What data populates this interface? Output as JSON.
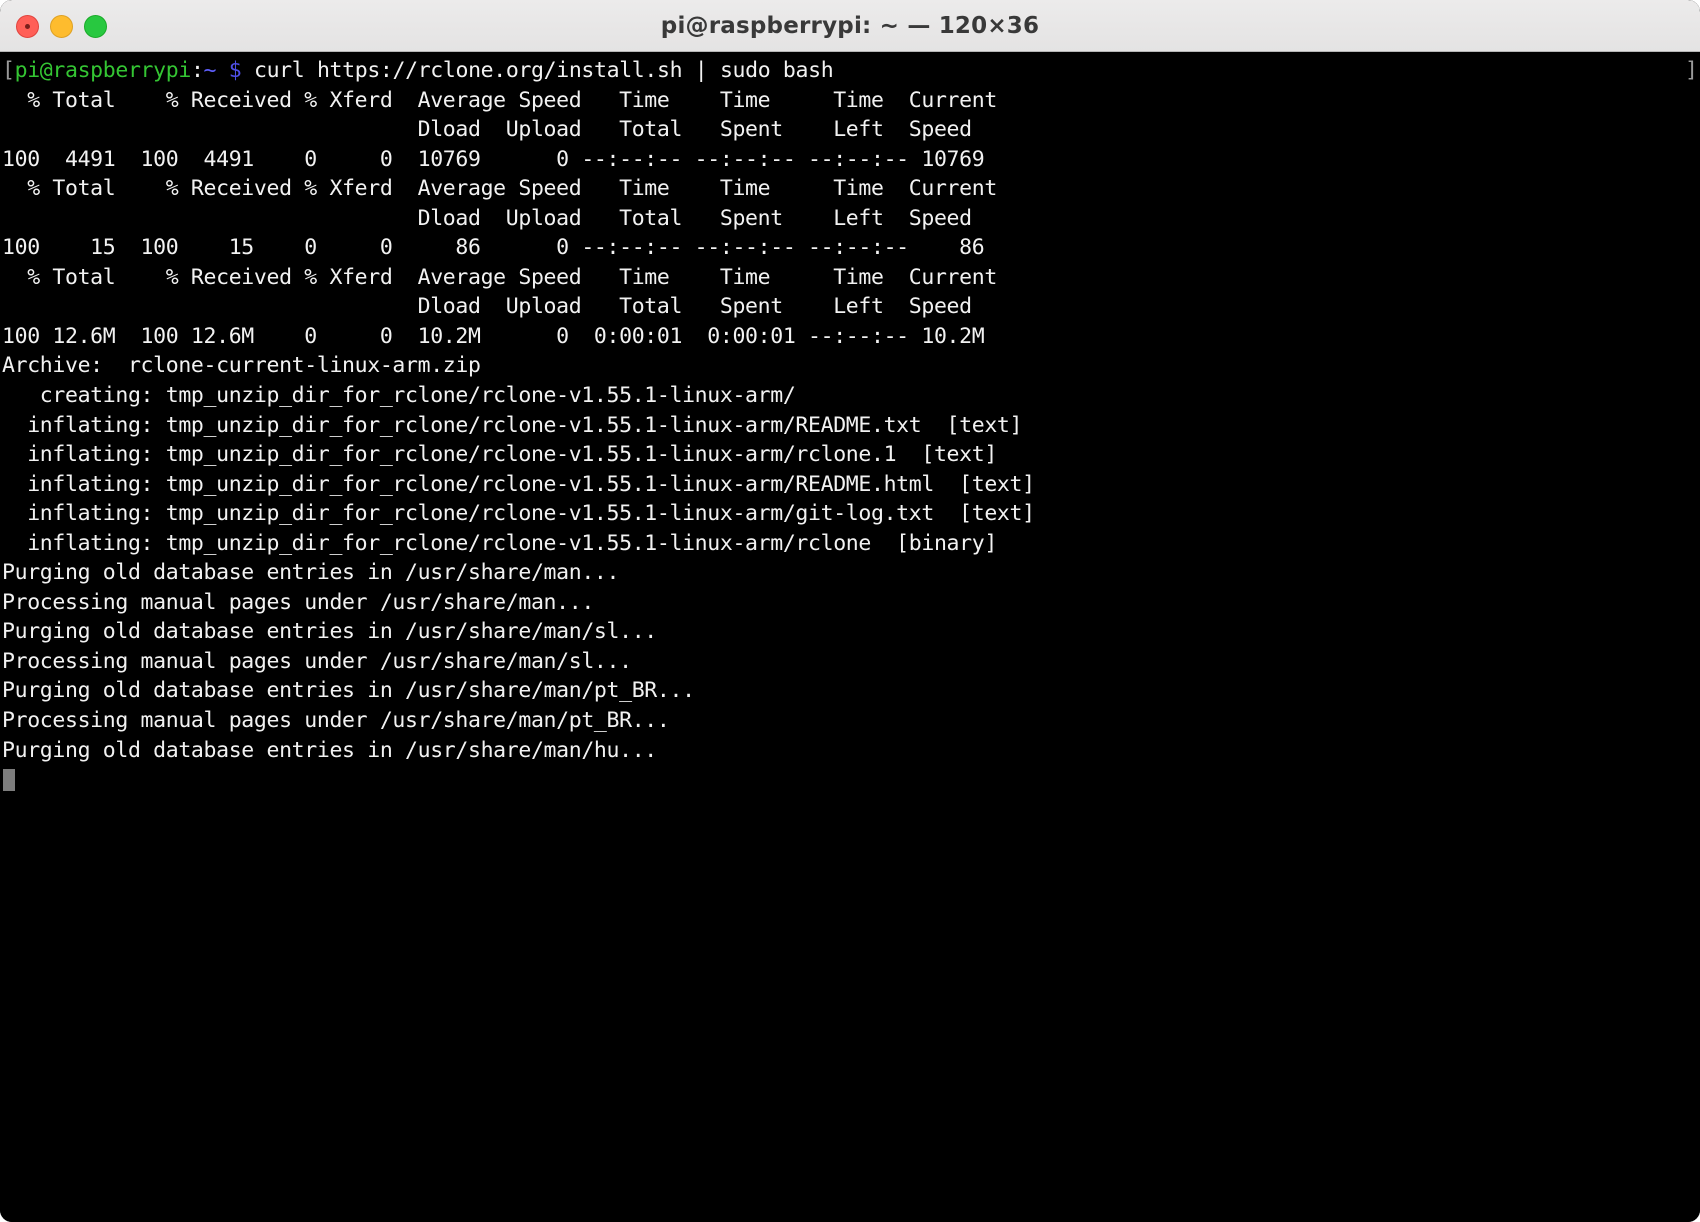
{
  "window": {
    "title": "pi@raspberrypi: ~ — 120×36",
    "columns": "120",
    "rows": "36",
    "traffic_lights": {
      "close_label": "close-window",
      "minimize_label": "minimize-window",
      "maximize_label": "maximize-window",
      "close_color": "#ff5f57",
      "minimize_color": "#febc2e",
      "maximize_color": "#28c840"
    },
    "titlebar_color": "#ebeaea",
    "background_color": "#000000",
    "foreground_color": "#f2f2f2"
  },
  "prompt": {
    "open_bracket": "[",
    "close_bracket": "]",
    "user_host": "pi@raspberrypi",
    "colon": ":",
    "path": "~",
    "sigil": "$",
    "command": " curl https://rclone.org/install.sh | sudo bash",
    "user_host_color": "#34c533",
    "path_color": "#5e5efb",
    "sigil_color": "#4f4fe8"
  },
  "curl_transfers": [
    {
      "header_1": "  % Total    % Received % Xferd  Average Speed   Time    Time     Time  Current",
      "header_2": "                                 Dload  Upload   Total   Spent    Left  Speed",
      "row": "100  4491  100  4491    0     0  10769      0 --:--:-- --:--:-- --:--:-- 10769"
    },
    {
      "header_1": "  % Total    % Received % Xferd  Average Speed   Time    Time     Time  Current",
      "header_2": "                                 Dload  Upload   Total   Spent    Left  Speed",
      "row": "100    15  100    15    0     0     86      0 --:--:-- --:--:-- --:--:--    86"
    },
    {
      "header_1": "  % Total    % Received % Xferd  Average Speed   Time    Time     Time  Current",
      "header_2": "                                 Dload  Upload   Total   Spent    Left  Speed",
      "row": "100 12.6M  100 12.6M    0     0  10.2M      0  0:00:01  0:00:01 --:--:-- 10.2M"
    }
  ],
  "unzip_output": [
    "Archive:  rclone-current-linux-arm.zip",
    "   creating: tmp_unzip_dir_for_rclone/rclone-v1.55.1-linux-arm/",
    "  inflating: tmp_unzip_dir_for_rclone/rclone-v1.55.1-linux-arm/README.txt  [text]",
    "  inflating: tmp_unzip_dir_for_rclone/rclone-v1.55.1-linux-arm/rclone.1  [text]",
    "  inflating: tmp_unzip_dir_for_rclone/rclone-v1.55.1-linux-arm/README.html  [text]",
    "  inflating: tmp_unzip_dir_for_rclone/rclone-v1.55.1-linux-arm/git-log.txt  [text]",
    "  inflating: tmp_unzip_dir_for_rclone/rclone-v1.55.1-linux-arm/rclone  [binary]"
  ],
  "mandb_output": [
    "Purging old database entries in /usr/share/man...",
    "Processing manual pages under /usr/share/man...",
    "Purging old database entries in /usr/share/man/sl...",
    "Processing manual pages under /usr/share/man/sl...",
    "Purging old database entries in /usr/share/man/pt_BR...",
    "Processing manual pages under /usr/share/man/pt_BR...",
    "Purging old database entries in /usr/share/man/hu..."
  ]
}
